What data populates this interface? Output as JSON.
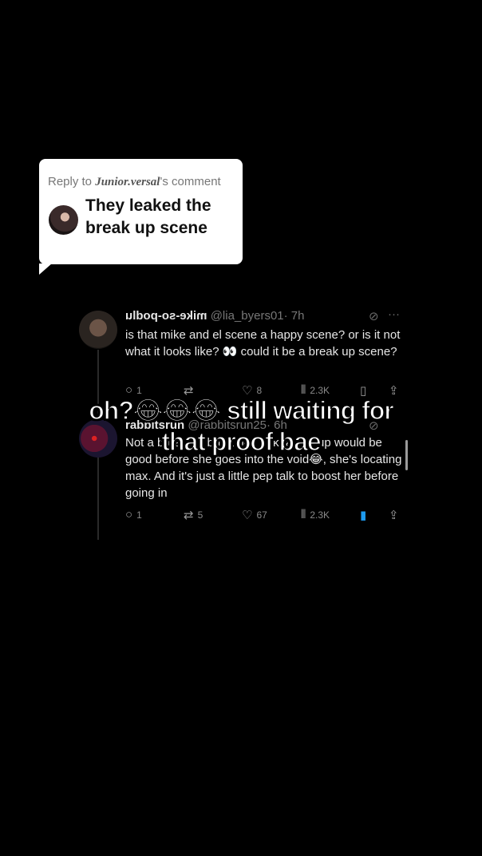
{
  "reply_card": {
    "prefix": "Reply to",
    "name": "Junior.versal",
    "suffix": "'s comment",
    "message": "They leaked the break up scene"
  },
  "tweets": [
    {
      "display_name": "mike-so-podlu",
      "handle": "@lia_byers01",
      "time": "· 7h",
      "text": "is that mike and el scene a happy scene? or is it not what it looks like? 👀 could it be a break up scene?",
      "replies": "1",
      "retweets": "",
      "likes": "8",
      "views": "2.3K"
    },
    {
      "display_name": "rabbitsrun",
      "handle": "@rabbitsrun25",
      "time": "· 6h",
      "text": "Not a break up but a pep talk, a talk up would be good before she goes into the void😂, she's locating max. And it's just a little pep talk to boost her before going in",
      "replies": "1",
      "retweets": "5",
      "likes": "67",
      "views": "2.3K"
    }
  ],
  "caption": {
    "line1": "oh?😂😂😂 still waiting for",
    "line2": "that proof bae"
  }
}
